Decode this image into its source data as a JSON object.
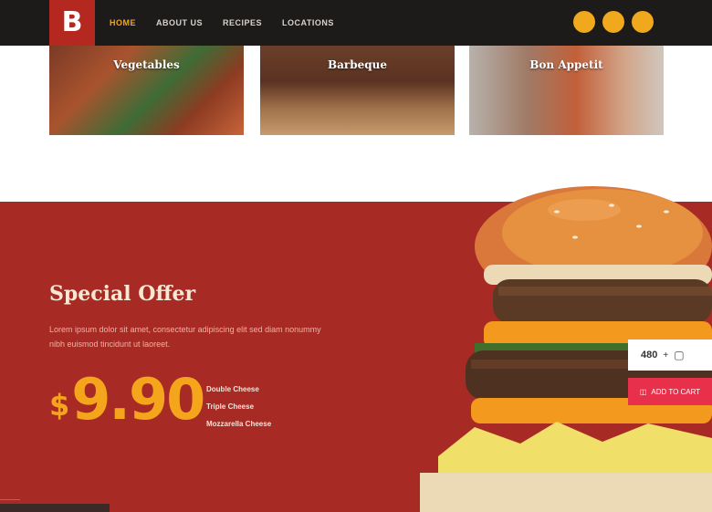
{
  "header": {
    "logo_letter": "B",
    "nav": [
      {
        "label": "HOME",
        "active": true
      },
      {
        "label": "ABOUT US",
        "active": false
      },
      {
        "label": "RECIPES",
        "active": false
      },
      {
        "label": "LOCATIONS",
        "active": false
      }
    ],
    "action_buttons": [
      "search-icon",
      "user-icon",
      "cart-icon"
    ]
  },
  "categories": [
    {
      "label": "Vegetables"
    },
    {
      "label": "Barbeque"
    },
    {
      "label": "Bon Appetit"
    }
  ],
  "offer": {
    "title": "Special Offer",
    "description": "Lorem ipsum dolor sit amet, consectetur adipiscing elit sed diam nonummy nibh euismod tincidunt ut laoreet.",
    "currency": "$",
    "price": "9.90",
    "features": [
      "Double Cheese",
      "Triple Cheese",
      "Mozzarella Cheese"
    ],
    "quantity": "480",
    "cart_button": "ADD TO CART"
  },
  "colors": {
    "accent": "#f4a51c",
    "offer_bg": "#a82a24",
    "logo_bg": "#b5281f",
    "cart_button": "#e8304a"
  }
}
